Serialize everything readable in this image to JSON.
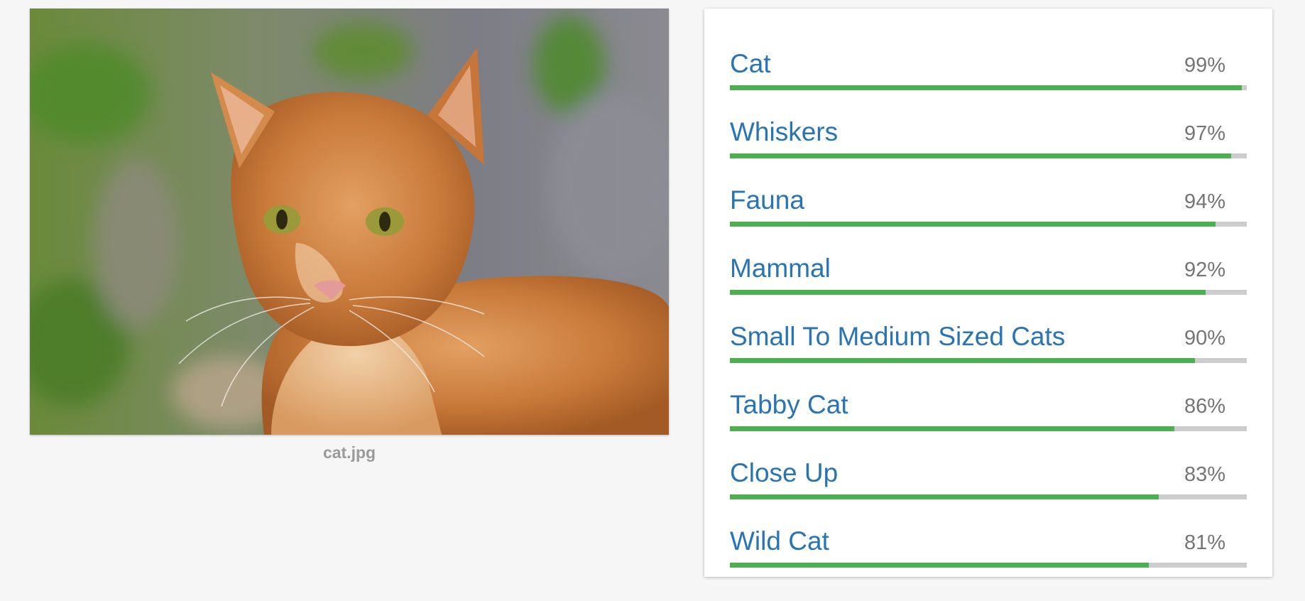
{
  "image": {
    "caption": "cat.jpg"
  },
  "labels": [
    {
      "name": "Cat",
      "score_text": "99%",
      "score": 0.99
    },
    {
      "name": "Whiskers",
      "score_text": "97%",
      "score": 0.97
    },
    {
      "name": "Fauna",
      "score_text": "94%",
      "score": 0.94
    },
    {
      "name": "Mammal",
      "score_text": "92%",
      "score": 0.92
    },
    {
      "name": "Small To Medium Sized Cats",
      "score_text": "90%",
      "score": 0.9
    },
    {
      "name": "Tabby Cat",
      "score_text": "86%",
      "score": 0.86
    },
    {
      "name": "Close Up",
      "score_text": "83%",
      "score": 0.83
    },
    {
      "name": "Wild Cat",
      "score_text": "81%",
      "score": 0.81
    }
  ],
  "colors": {
    "label_text": "#2874b4",
    "bar_fill": "#4caf50",
    "bar_track": "#cccccc",
    "score_text": "#757575",
    "caption_text": "#9a9a9a"
  }
}
